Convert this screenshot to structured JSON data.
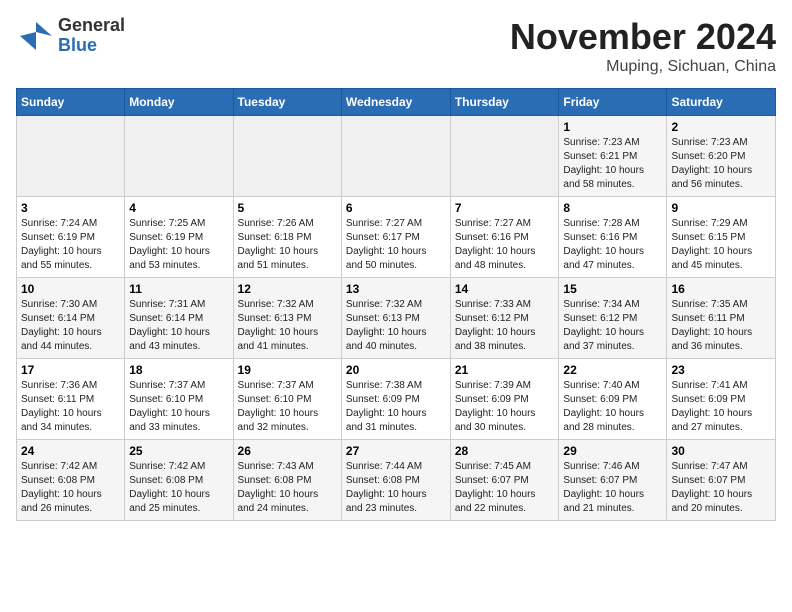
{
  "header": {
    "logo_line1": "General",
    "logo_line2": "Blue",
    "month_year": "November 2024",
    "location": "Muping, Sichuan, China"
  },
  "weekdays": [
    "Sunday",
    "Monday",
    "Tuesday",
    "Wednesday",
    "Thursday",
    "Friday",
    "Saturday"
  ],
  "weeks": [
    [
      {
        "day": "",
        "info": ""
      },
      {
        "day": "",
        "info": ""
      },
      {
        "day": "",
        "info": ""
      },
      {
        "day": "",
        "info": ""
      },
      {
        "day": "",
        "info": ""
      },
      {
        "day": "1",
        "info": "Sunrise: 7:23 AM\nSunset: 6:21 PM\nDaylight: 10 hours\nand 58 minutes."
      },
      {
        "day": "2",
        "info": "Sunrise: 7:23 AM\nSunset: 6:20 PM\nDaylight: 10 hours\nand 56 minutes."
      }
    ],
    [
      {
        "day": "3",
        "info": "Sunrise: 7:24 AM\nSunset: 6:19 PM\nDaylight: 10 hours\nand 55 minutes."
      },
      {
        "day": "4",
        "info": "Sunrise: 7:25 AM\nSunset: 6:19 PM\nDaylight: 10 hours\nand 53 minutes."
      },
      {
        "day": "5",
        "info": "Sunrise: 7:26 AM\nSunset: 6:18 PM\nDaylight: 10 hours\nand 51 minutes."
      },
      {
        "day": "6",
        "info": "Sunrise: 7:27 AM\nSunset: 6:17 PM\nDaylight: 10 hours\nand 50 minutes."
      },
      {
        "day": "7",
        "info": "Sunrise: 7:27 AM\nSunset: 6:16 PM\nDaylight: 10 hours\nand 48 minutes."
      },
      {
        "day": "8",
        "info": "Sunrise: 7:28 AM\nSunset: 6:16 PM\nDaylight: 10 hours\nand 47 minutes."
      },
      {
        "day": "9",
        "info": "Sunrise: 7:29 AM\nSunset: 6:15 PM\nDaylight: 10 hours\nand 45 minutes."
      }
    ],
    [
      {
        "day": "10",
        "info": "Sunrise: 7:30 AM\nSunset: 6:14 PM\nDaylight: 10 hours\nand 44 minutes."
      },
      {
        "day": "11",
        "info": "Sunrise: 7:31 AM\nSunset: 6:14 PM\nDaylight: 10 hours\nand 43 minutes."
      },
      {
        "day": "12",
        "info": "Sunrise: 7:32 AM\nSunset: 6:13 PM\nDaylight: 10 hours\nand 41 minutes."
      },
      {
        "day": "13",
        "info": "Sunrise: 7:32 AM\nSunset: 6:13 PM\nDaylight: 10 hours\nand 40 minutes."
      },
      {
        "day": "14",
        "info": "Sunrise: 7:33 AM\nSunset: 6:12 PM\nDaylight: 10 hours\nand 38 minutes."
      },
      {
        "day": "15",
        "info": "Sunrise: 7:34 AM\nSunset: 6:12 PM\nDaylight: 10 hours\nand 37 minutes."
      },
      {
        "day": "16",
        "info": "Sunrise: 7:35 AM\nSunset: 6:11 PM\nDaylight: 10 hours\nand 36 minutes."
      }
    ],
    [
      {
        "day": "17",
        "info": "Sunrise: 7:36 AM\nSunset: 6:11 PM\nDaylight: 10 hours\nand 34 minutes."
      },
      {
        "day": "18",
        "info": "Sunrise: 7:37 AM\nSunset: 6:10 PM\nDaylight: 10 hours\nand 33 minutes."
      },
      {
        "day": "19",
        "info": "Sunrise: 7:37 AM\nSunset: 6:10 PM\nDaylight: 10 hours\nand 32 minutes."
      },
      {
        "day": "20",
        "info": "Sunrise: 7:38 AM\nSunset: 6:09 PM\nDaylight: 10 hours\nand 31 minutes."
      },
      {
        "day": "21",
        "info": "Sunrise: 7:39 AM\nSunset: 6:09 PM\nDaylight: 10 hours\nand 30 minutes."
      },
      {
        "day": "22",
        "info": "Sunrise: 7:40 AM\nSunset: 6:09 PM\nDaylight: 10 hours\nand 28 minutes."
      },
      {
        "day": "23",
        "info": "Sunrise: 7:41 AM\nSunset: 6:09 PM\nDaylight: 10 hours\nand 27 minutes."
      }
    ],
    [
      {
        "day": "24",
        "info": "Sunrise: 7:42 AM\nSunset: 6:08 PM\nDaylight: 10 hours\nand 26 minutes."
      },
      {
        "day": "25",
        "info": "Sunrise: 7:42 AM\nSunset: 6:08 PM\nDaylight: 10 hours\nand 25 minutes."
      },
      {
        "day": "26",
        "info": "Sunrise: 7:43 AM\nSunset: 6:08 PM\nDaylight: 10 hours\nand 24 minutes."
      },
      {
        "day": "27",
        "info": "Sunrise: 7:44 AM\nSunset: 6:08 PM\nDaylight: 10 hours\nand 23 minutes."
      },
      {
        "day": "28",
        "info": "Sunrise: 7:45 AM\nSunset: 6:07 PM\nDaylight: 10 hours\nand 22 minutes."
      },
      {
        "day": "29",
        "info": "Sunrise: 7:46 AM\nSunset: 6:07 PM\nDaylight: 10 hours\nand 21 minutes."
      },
      {
        "day": "30",
        "info": "Sunrise: 7:47 AM\nSunset: 6:07 PM\nDaylight: 10 hours\nand 20 minutes."
      }
    ]
  ]
}
